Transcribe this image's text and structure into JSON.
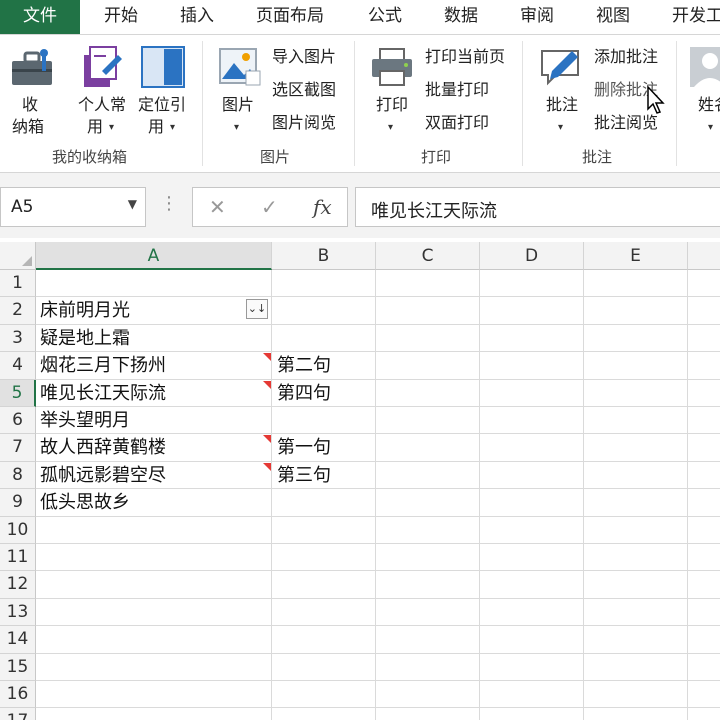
{
  "tabs": [
    "文件",
    "开始",
    "插入",
    "页面布局",
    "公式",
    "数据",
    "审阅",
    "视图",
    "开发工"
  ],
  "ribbon": {
    "storage": {
      "label_line1": "收",
      "label_line2": "纳箱",
      "group": "我的收纳箱"
    },
    "personal": {
      "line1": "个人常",
      "line2": "用"
    },
    "locate": {
      "line1": "定位引",
      "line2": "用"
    },
    "picture": {
      "label": "图片",
      "group": "图片",
      "items": [
        "导入图片",
        "选区截图",
        "图片阅览"
      ]
    },
    "print": {
      "label": "打印",
      "group": "打印",
      "items": [
        "打印当前页",
        "批量打印",
        "双面打印"
      ]
    },
    "comment": {
      "label": "批注",
      "group": "批注",
      "items": [
        "添加批注",
        "删除批注",
        "批注阅览"
      ]
    },
    "name": {
      "label": "姓名"
    }
  },
  "formula_bar": {
    "name_box": "A5",
    "fx": "fx",
    "cancel": "✕",
    "confirm": "✓",
    "content": "唯见长江天际流"
  },
  "grid": {
    "columns": [
      "A",
      "B",
      "C",
      "D",
      "E"
    ],
    "rows": [
      "1",
      "2",
      "3",
      "4",
      "5",
      "6",
      "7",
      "8",
      "9",
      "10",
      "11",
      "12",
      "13",
      "14",
      "15",
      "16",
      "17"
    ],
    "col_a": [
      "",
      "床前明月光",
      "疑是地上霜",
      "烟花三月下扬州",
      "唯见长江天际流",
      "举头望明月",
      "故人西辞黄鹤楼",
      "孤帆远影碧空尽",
      "低头思故乡"
    ],
    "col_b": [
      "",
      "",
      "",
      "第二句",
      "第四句",
      "",
      "第一句",
      "第三句",
      ""
    ]
  },
  "colors": {
    "accent": "#217346",
    "comment_mark": "#e53935"
  }
}
